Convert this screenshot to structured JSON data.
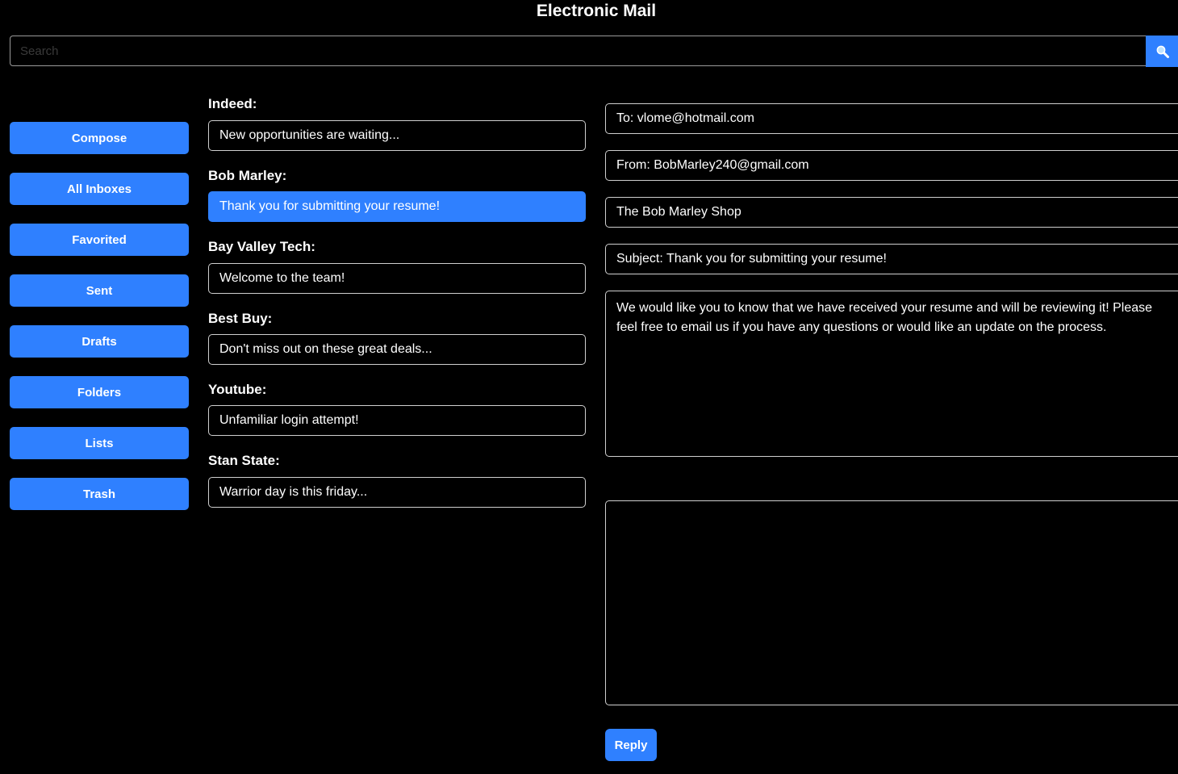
{
  "app": {
    "title": "Electronic Mail"
  },
  "search": {
    "placeholder": "Search",
    "icon": "magnifier-icon"
  },
  "sidebar": {
    "items": [
      {
        "label": "Compose"
      },
      {
        "label": "All Inboxes"
      },
      {
        "label": "Favorited"
      },
      {
        "label": "Sent"
      },
      {
        "label": "Drafts"
      },
      {
        "label": "Folders"
      },
      {
        "label": "Lists"
      },
      {
        "label": "Trash"
      }
    ]
  },
  "messages": [
    {
      "sender": "Indeed:",
      "preview": "New opportunities are waiting...",
      "selected": false
    },
    {
      "sender": "Bob Marley:",
      "preview": "Thank you for submitting your resume!",
      "selected": true
    },
    {
      "sender": "Bay Valley Tech:",
      "preview": "Welcome to the team!",
      "selected": false
    },
    {
      "sender": "Best Buy:",
      "preview": "Don't miss out on these great deals...",
      "selected": false
    },
    {
      "sender": "Youtube:",
      "preview": "Unfamiliar login attempt!",
      "selected": false
    },
    {
      "sender": "Stan State:",
      "preview": "Warrior day is this friday...",
      "selected": false
    }
  ],
  "email": {
    "to": "To: vlome@hotmail.com",
    "from": "From: BobMarley240@gmail.com",
    "organization": "The Bob Marley Shop",
    "subject": "Subject: Thank you for submitting your resume!",
    "body": "We would like you to know that we have received your resume and will be reviewing it! Please feel free to email us if you have any questions or would like an update on the process.",
    "reply_text": ""
  },
  "actions": {
    "reply_label": "Reply"
  },
  "colors": {
    "accent": "#2f80ff",
    "background": "#000000",
    "border": "#cfcfcf"
  }
}
